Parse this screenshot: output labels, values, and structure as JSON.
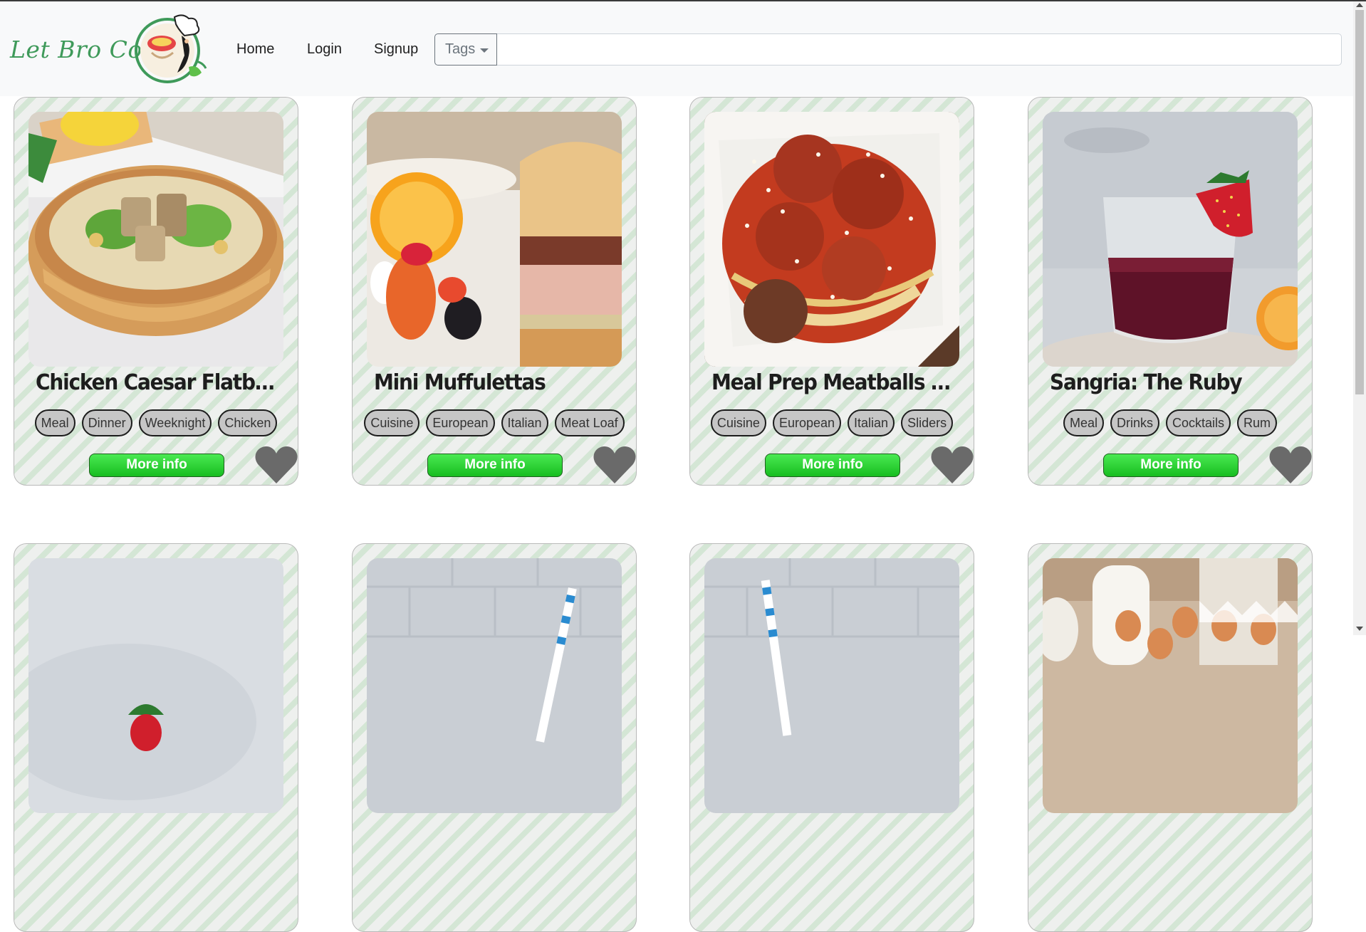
{
  "brand": {
    "name": "Let Bro Cook"
  },
  "nav": {
    "links": [
      {
        "label": "Home"
      },
      {
        "label": "Login"
      },
      {
        "label": "Signup"
      }
    ]
  },
  "search": {
    "tags_button": "Tags",
    "value": "",
    "placeholder": ""
  },
  "colors": {
    "accent_green": "#22c42a",
    "heart_gray": "#6a6a6a",
    "tag_pill": "#c6c6c6",
    "stripe_green": "#d4e6d5"
  },
  "cards": [
    {
      "title": "Chicken Caesar Flatbrea…",
      "image": "chicken-caesar-salad-bowl",
      "tags": [
        "Meal",
        "Dinner",
        "Weeknight",
        "Chicken"
      ],
      "button": "More info",
      "favorite_icon": "heart-icon"
    },
    {
      "title": "Mini Muffulettas",
      "image": "muffuletta-sandwich",
      "tags": [
        "Cuisine",
        "European",
        "Italian",
        "Meat Loaf"
      ],
      "button": "More info",
      "favorite_icon": "heart-icon"
    },
    {
      "title": "Meal Prep Meatballs And …",
      "image": "spaghetti-meatballs",
      "tags": [
        "Cuisine",
        "European",
        "Italian",
        "Sliders"
      ],
      "button": "More info",
      "favorite_icon": "heart-icon"
    },
    {
      "title": "Sangria: The Ruby",
      "image": "sangria-glass-strawberry",
      "tags": [
        "Meal",
        "Drinks",
        "Cocktails",
        "Rum"
      ],
      "button": "More info",
      "favorite_icon": "heart-icon"
    },
    {
      "image": "strawberry-drink"
    },
    {
      "image": "straw-drink-tiles"
    },
    {
      "image": "straw-drink-tiles-2"
    },
    {
      "image": "milk-and-eggs"
    }
  ]
}
